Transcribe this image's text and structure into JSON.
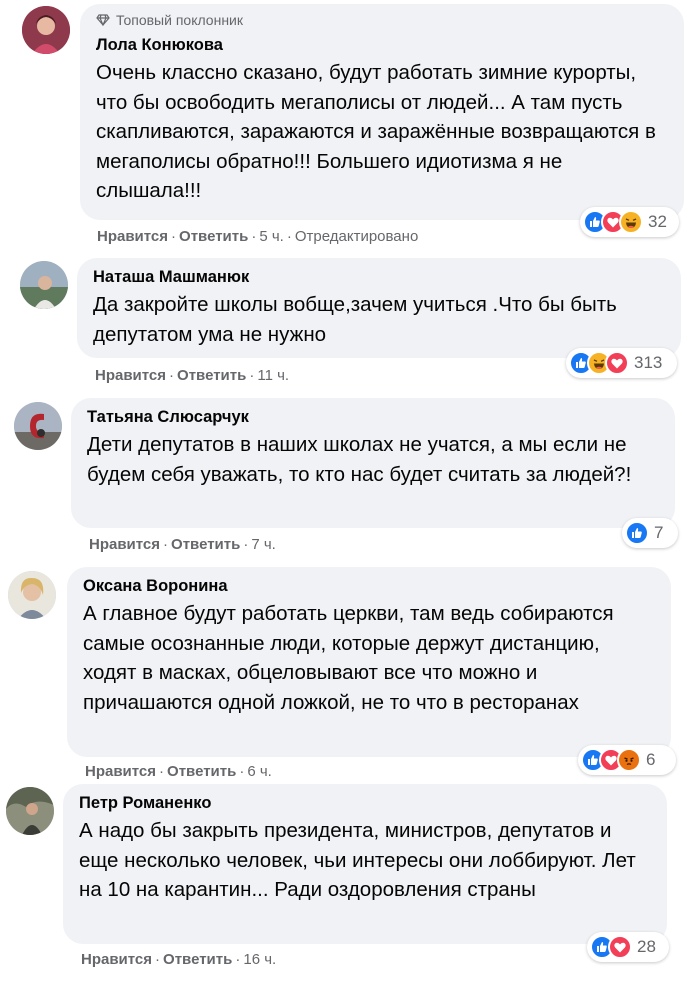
{
  "actions": {
    "like_label": "Нравится",
    "reply_label": "Ответить",
    "separator": "·"
  },
  "comments": [
    {
      "badge": "Топовый поклонник",
      "author": "Лола Конюкова",
      "text": "Очень классно сказано, будут работать зимние курорты, что бы освободить мегаполисы от людей... А там пусть скапливаются, заражаются и заражённые возвращаются в мегаполисы обратно!!! Большего идиотизма я не слышала!!!",
      "time": "5 ч.",
      "edited": "Отредактировано",
      "reactions": [
        "like-icon",
        "love-icon",
        "haha-icon"
      ],
      "reaction_count": "32"
    },
    {
      "author": "Наташа Машманюк",
      "text": "Да закройте школы вобще,зачем учиться .Что бы быть депутатом ума не нужно",
      "time": "11 ч.",
      "reactions": [
        "like-icon",
        "haha-icon",
        "love-icon"
      ],
      "reaction_count": "313"
    },
    {
      "author": "Татьяна Слюсарчук",
      "text": "Дети депутатов в наших школах не учатся, а мы если не будем себя уважать, то кто нас будет считать за людей?!",
      "time": "7 ч.",
      "reactions": [
        "like-icon"
      ],
      "reaction_count": "7"
    },
    {
      "author": "Оксана Воронина",
      "text": "А главное будут работать церкви, там ведь собираются самые осознанные люди, которые держут дистанцию, ходят в масках, обцеловывают все что можно и причашаются одной ложкой, не то что в ресторанах",
      "time": "6 ч.",
      "reactions": [
        "like-icon",
        "love-icon",
        "angry-icon"
      ],
      "reaction_count": "6"
    },
    {
      "author": "Петр Романенко",
      "text": "А надо бы закрыть президента, министров, депутатов и еще несколько человек, чьи интересы они лоббируют. Лет на 10 на карантин... Ради оздоровления страны",
      "time": "16 ч.",
      "reactions": [
        "like-icon",
        "love-icon"
      ],
      "reaction_count": "28"
    }
  ],
  "colors": {
    "bubble": "#f0f2f5",
    "like": "#1877f2",
    "love": "#f33e58",
    "haha": "#f7b125",
    "angry": "#e9710f",
    "meta": "#65676b"
  }
}
